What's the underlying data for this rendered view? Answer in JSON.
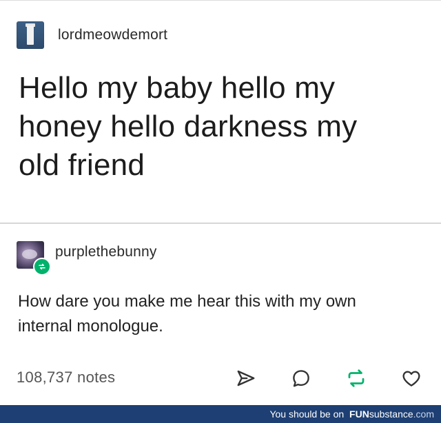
{
  "post1": {
    "username": "lordmeowdemort",
    "avatar_icon": "pillar-avatar-icon",
    "body_lines": [
      "Hello my baby hello my",
      "honey hello darkness my",
      "old friend"
    ]
  },
  "post2": {
    "username": "purplethebunny",
    "avatar_icon": "bunny-avatar-icon",
    "badge_icon": "reblog-badge-icon",
    "body_lines": [
      "How dare you make me hear this with my own",
      "internal monologue."
    ]
  },
  "footer": {
    "notes": "108,737 notes",
    "actions": [
      "share-icon",
      "comment-icon",
      "reblog-icon",
      "like-icon"
    ]
  },
  "watermark": {
    "prefix": "You should be on",
    "brand_bold": "FUN",
    "brand_rest": "substance",
    "tld": ".com"
  },
  "colors": {
    "reblog_green": "#00b26b",
    "watermark_bg": "#1d3f73",
    "icon_gray": "#333333"
  }
}
